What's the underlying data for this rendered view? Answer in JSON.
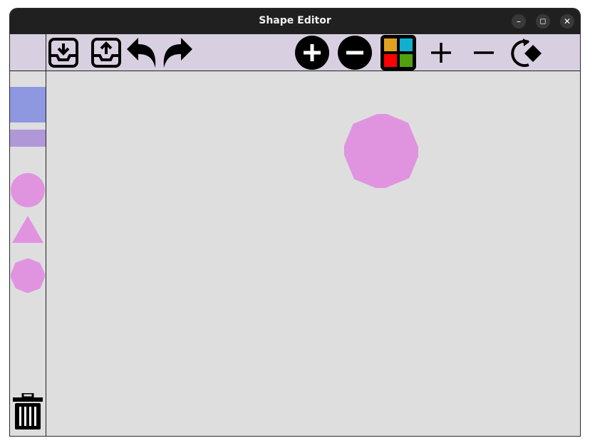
{
  "window": {
    "title": "Shape Editor",
    "controls": {
      "minimize": "–",
      "maximize": "◻",
      "close": "✕"
    }
  },
  "toolbar": {
    "tools": [
      {
        "name": "save",
        "icon": "tray-download-icon"
      },
      {
        "name": "load",
        "icon": "tray-upload-icon"
      },
      {
        "name": "undo",
        "icon": "undo-arrow-icon"
      },
      {
        "name": "redo",
        "icon": "redo-arrow-icon"
      },
      {
        "name": "zoom-in",
        "icon": "circle-plus-icon"
      },
      {
        "name": "zoom-out",
        "icon": "circle-minus-icon"
      },
      {
        "name": "color-picker",
        "icon": "color-grid-icon",
        "colors": [
          "#e0a020",
          "#10b0d0",
          "#ff0000",
          "#50a010"
        ]
      },
      {
        "name": "grow",
        "icon": "plus-icon"
      },
      {
        "name": "shrink",
        "icon": "minus-icon"
      },
      {
        "name": "rotate",
        "icon": "rotate-icon"
      }
    ]
  },
  "palette": {
    "shapes": [
      {
        "type": "square",
        "color": "#8e98e0"
      },
      {
        "type": "rectangle",
        "color": "#b098d8"
      },
      {
        "type": "circle",
        "color": "#e094e0"
      },
      {
        "type": "triangle",
        "color": "#e094e0"
      },
      {
        "type": "octagon",
        "color": "#e094e0"
      }
    ],
    "trash": {
      "icon": "trash-icon"
    }
  },
  "canvas": {
    "background": "#dedede",
    "shapes": [
      {
        "type": "octagon",
        "color": "#e094e0"
      }
    ]
  },
  "colors": {
    "titlebar": "#202020",
    "toolbar": "#d8d0e0",
    "canvas": "#dedede"
  }
}
